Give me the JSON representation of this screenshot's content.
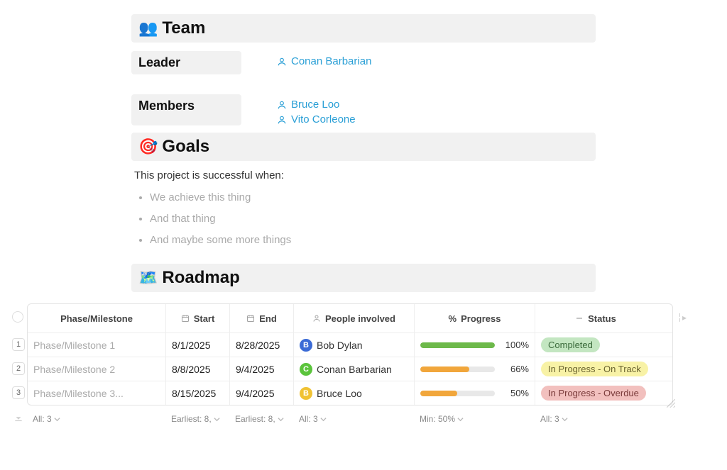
{
  "sections": {
    "team": {
      "emoji": "👥",
      "title": "Team"
    },
    "goals": {
      "emoji": "🎯",
      "title": "Goals"
    },
    "roadmap": {
      "emoji": "🗺️",
      "title": "Roadmap"
    }
  },
  "team": {
    "leader_label": "Leader",
    "leader": "Conan Barbarian",
    "members_label": "Members",
    "members": [
      "Bruce Loo",
      "Vito Corleone"
    ]
  },
  "goals": {
    "intro": "This project is successful when:",
    "items": [
      "We achieve this thing",
      "And that thing",
      "And maybe some more things"
    ]
  },
  "roadmap": {
    "columns": {
      "phase": "Phase/Milestone",
      "start": "Start",
      "end": "End",
      "people": "People involved",
      "progress": "Progress",
      "progress_icon": "%",
      "status": "Status"
    },
    "rows": [
      {
        "num": "1",
        "phase": "Phase/Milestone 1",
        "start": "8/1/2025",
        "end": "8/28/2025",
        "person": "Bob Dylan",
        "initial": "B",
        "avatar_color": "av-b",
        "progress_pct": "100%",
        "progress_w": "100%",
        "progress_color": "pb-green",
        "status": "Completed",
        "status_class": "sp-green"
      },
      {
        "num": "2",
        "phase": "Phase/Milestone 2",
        "start": "8/8/2025",
        "end": "9/4/2025",
        "person": "Conan Barbarian",
        "initial": "C",
        "avatar_color": "av-c",
        "progress_pct": "66%",
        "progress_w": "66%",
        "progress_color": "pb-orange",
        "status": "In Progress - On Track",
        "status_class": "sp-yellow"
      },
      {
        "num": "3",
        "phase": "Phase/Milestone 3...",
        "start": "8/15/2025",
        "end": "9/4/2025",
        "person": "Bruce Loo",
        "initial": "B",
        "avatar_color": "av-y",
        "progress_pct": "50%",
        "progress_w": "50%",
        "progress_color": "pb-orange",
        "status": "In Progress - Overdue",
        "status_class": "sp-red"
      }
    ],
    "footer": {
      "phase": "All: 3",
      "start": "Earliest: 8,",
      "end": "Earliest: 8,",
      "people": "All: 3",
      "progress": "Min: 50%",
      "status": "All: 3"
    }
  }
}
